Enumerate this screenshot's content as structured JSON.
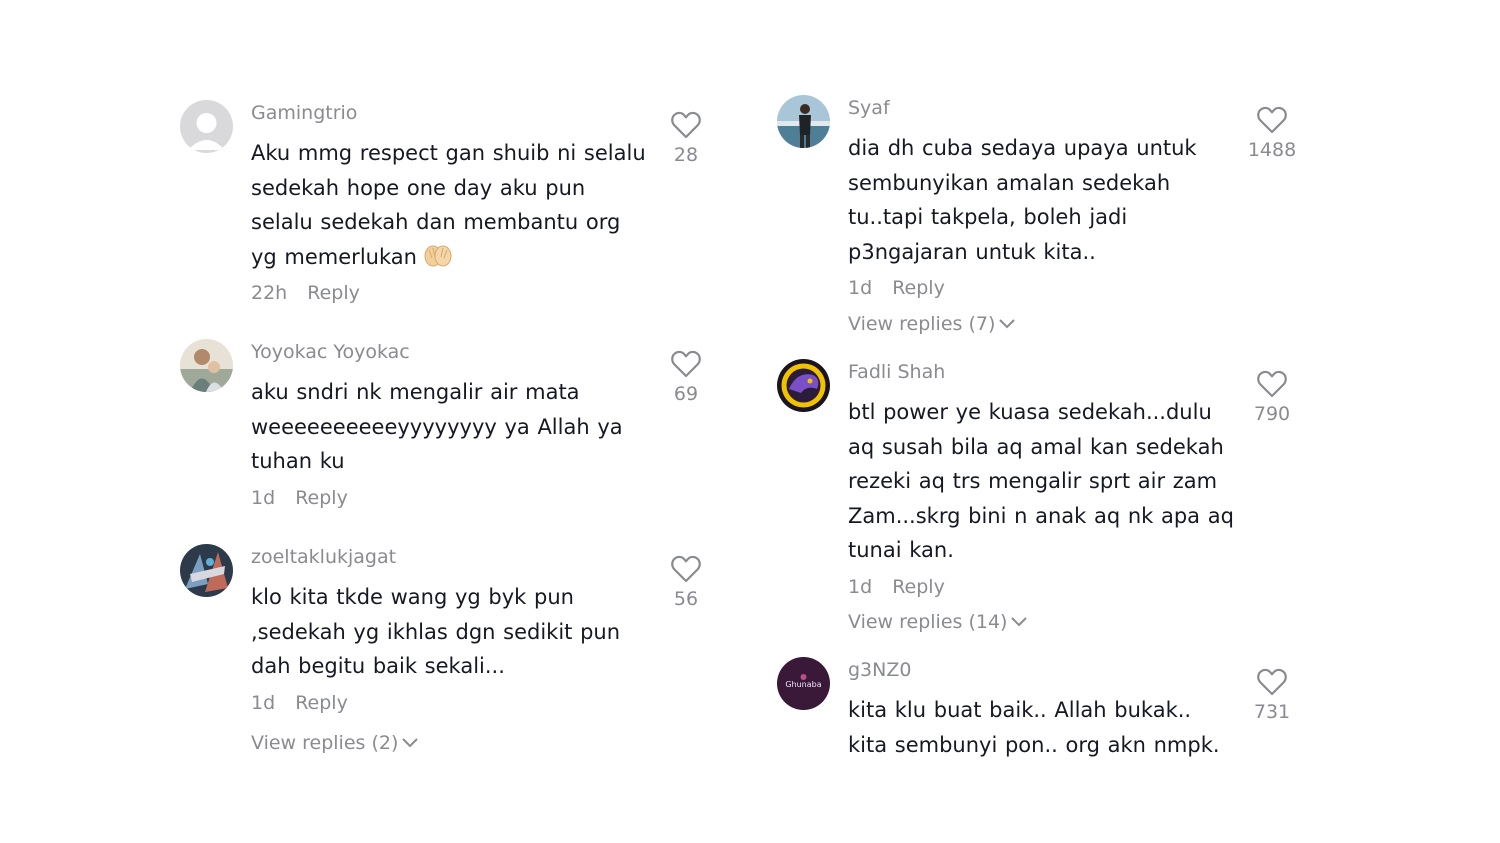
{
  "comments_left": [
    {
      "username": "Gamingtrio",
      "text": "Aku mmg respect gan shuib ni selalu sedekah hope one day aku pun selalu sedekah dan membantu org yg memerlukan",
      "emoji": "folded-hands-emoji",
      "time": "22h",
      "reply": "Reply",
      "likes": "28",
      "avatar": "default-avatar"
    },
    {
      "username": "Yoyokac Yoyokac",
      "text": "aku sndri nk mengalir air mata weeeeeeeeeeyyyyyyyy ya Allah ya tuhan ku",
      "time": "1d",
      "reply": "Reply",
      "likes": "69",
      "avatar": "user-photo-avatar"
    },
    {
      "username": "zoeltaklukjagat",
      "text": "klo kita tkde wang yg byk pun ,sedekah yg ikhlas dgn sedikit pun dah begitu baik sekali...",
      "time": "1d",
      "reply": "Reply",
      "likes": "56",
      "view_replies": "View replies (2)",
      "avatar": "user-photo-avatar"
    }
  ],
  "comments_right": [
    {
      "username": "Syaf",
      "text": "dia dh cuba sedaya upaya untuk sembunyikan amalan sedekah tu..tapi takpela, boleh jadi p3ngajaran untuk kita..",
      "time": "1d",
      "reply": "Reply",
      "likes": "1488",
      "view_replies": "View replies (7)",
      "avatar": "user-photo-avatar"
    },
    {
      "username": "Fadli Shah",
      "text": "btl power ye kuasa sedekah...dulu aq susah bila aq amal kan sedekah rezeki aq trs mengalir sprt air zam Zam...skrg bini n anak aq nk apa aq tunai kan.",
      "time": "1d",
      "reply": "Reply",
      "likes": "790",
      "view_replies": "View replies (14)",
      "avatar": "logo-avatar"
    },
    {
      "username": "g3NZ0",
      "text": "kita klu buat baik.. Allah bukak.. kita sembunyi pon.. org akn nmpk.",
      "likes": "731",
      "avatar": "logo-avatar",
      "avatar_text": "Ghunaba"
    }
  ],
  "colors": {
    "text": "#161823",
    "muted": "#8a8b91",
    "background": "#ffffff"
  }
}
